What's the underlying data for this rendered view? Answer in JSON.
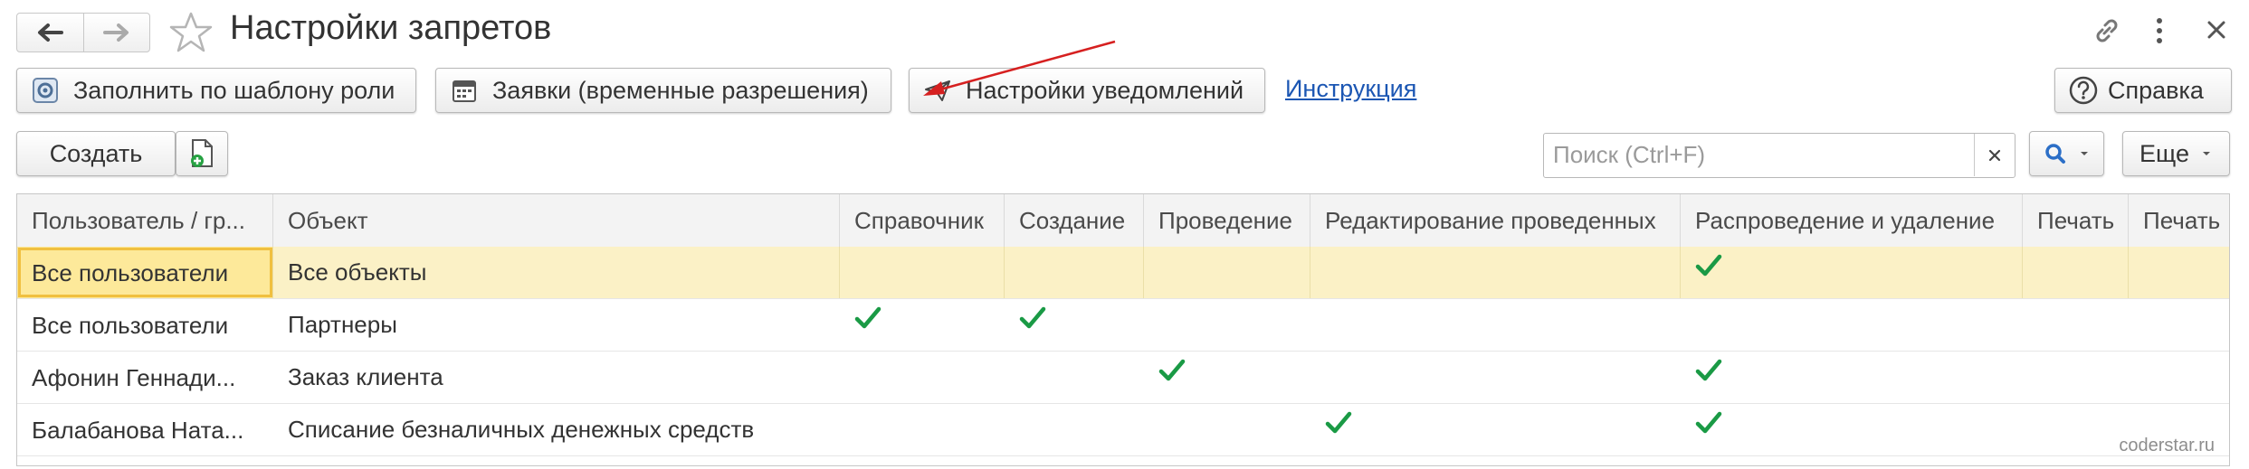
{
  "window": {
    "title": "Настройки запретов",
    "back_icon": "arrow-left-icon",
    "forward_icon": "arrow-right-icon",
    "favorite_icon": "star-outline-icon",
    "link_icon": "chain-link-icon",
    "menu_icon": "vertical-dots-icon",
    "close_icon": "close-icon"
  },
  "toolbar": {
    "fill_role": "Заполнить по шаблону роли",
    "requests": "Заявки (временные разрешения)",
    "notifications": "Настройки уведомлений",
    "instruction": "Инструкция",
    "help": "Справка"
  },
  "commands": {
    "create": "Создать",
    "search_placeholder": "Поиск (Ctrl+F)",
    "more": "Еще"
  },
  "colors": {
    "check": "#1a9a45",
    "selected_row": "#fbf1c6",
    "link": "#1b56b3",
    "annotation_arrow": "#d62020"
  },
  "table": {
    "columns": [
      "Пользователь / гр...",
      "Объект",
      "Справочник",
      "Создание",
      "Проведение",
      "Редактирование проведенных",
      "Распроведение и удаление",
      "Печать",
      "Печать"
    ],
    "rows": [
      {
        "user": "Все пользователи",
        "object": "Все объекты",
        "checks": [
          false,
          false,
          false,
          false,
          true,
          false,
          false
        ]
      },
      {
        "user": "Все пользователи",
        "object": "Партнеры",
        "checks": [
          true,
          true,
          false,
          false,
          false,
          false,
          false
        ]
      },
      {
        "user": "Афонин Геннади...",
        "object": "Заказ клиента",
        "checks": [
          false,
          false,
          true,
          false,
          true,
          false,
          false
        ]
      },
      {
        "user": "Балабанова Ната...",
        "object": "Списание безналичных денежных средств",
        "checks": [
          false,
          false,
          false,
          true,
          true,
          false,
          false
        ]
      }
    ]
  },
  "watermark": "coderstar.ru"
}
